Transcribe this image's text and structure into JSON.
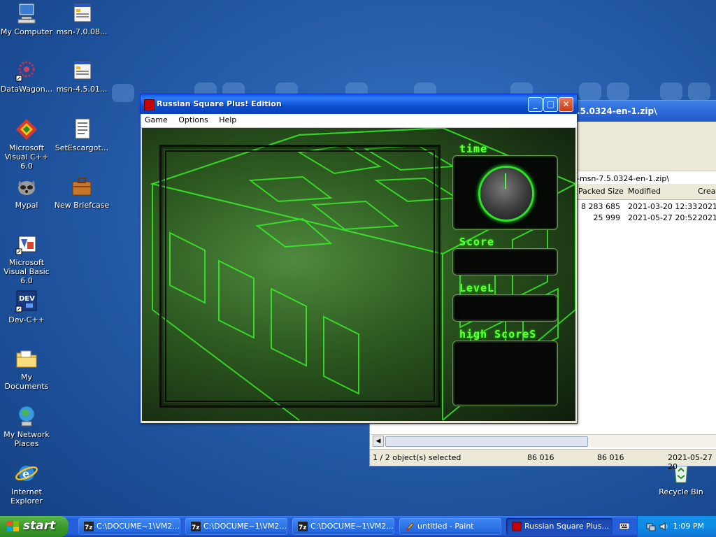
{
  "desktop": {
    "icons": [
      {
        "label": "My Computer"
      },
      {
        "label": "msn-7.0.08..."
      },
      {
        "label": "DataWagon..."
      },
      {
        "label": "msn-4.5.01..."
      },
      {
        "label": "Microsoft Visual C++ 6.0"
      },
      {
        "label": "SetEscargot..."
      },
      {
        "label": "Mypal"
      },
      {
        "label": "New Briefcase"
      },
      {
        "label": "Microsoft Visual Basic 6.0"
      },
      {
        "label": "Dev-C++"
      },
      {
        "label": "My Documents"
      },
      {
        "label": "My Network Places"
      },
      {
        "label": "Internet Explorer"
      },
      {
        "label": "Recycle Bin"
      }
    ]
  },
  "sevenzip": {
    "title": ".5.0324-en-1.zip\\",
    "address": "-msn-7.5.0324-en-1.zip\\",
    "columns": [
      "Packed Size",
      "Modified",
      "Creat"
    ],
    "rows": [
      {
        "packed": "8 283 685",
        "modified": "2021-03-20 12:33",
        "created": "2021-"
      },
      {
        "packed": "25 999",
        "modified": "2021-05-27 20:52",
        "created": "2021-"
      }
    ],
    "status": {
      "selected": "1 / 2 object(s) selected",
      "size": "86 016",
      "packed": "86 016",
      "date": "2021-05-27 20"
    }
  },
  "game": {
    "title": "Russian Square Plus! Edition",
    "menu": [
      "Game",
      "Options",
      "Help"
    ],
    "panels": {
      "time": "time",
      "score": "Score",
      "level": "LeveL",
      "highscores": "high ScoreS"
    }
  },
  "taskbar": {
    "start": "start",
    "items": [
      {
        "label": "C:\\DOCUME~1\\VM2..."
      },
      {
        "label": "C:\\DOCUME~1\\VM2..."
      },
      {
        "label": "C:\\DOCUME~1\\VM2..."
      },
      {
        "label": "untitled - Paint"
      },
      {
        "label": "Russian Square Plus..."
      }
    ],
    "clock": "1:09 PM"
  },
  "colors": {
    "accent_green": "#2fe02a",
    "xp_blue": "#245edb",
    "desktop_blue": "#2a62b0"
  }
}
